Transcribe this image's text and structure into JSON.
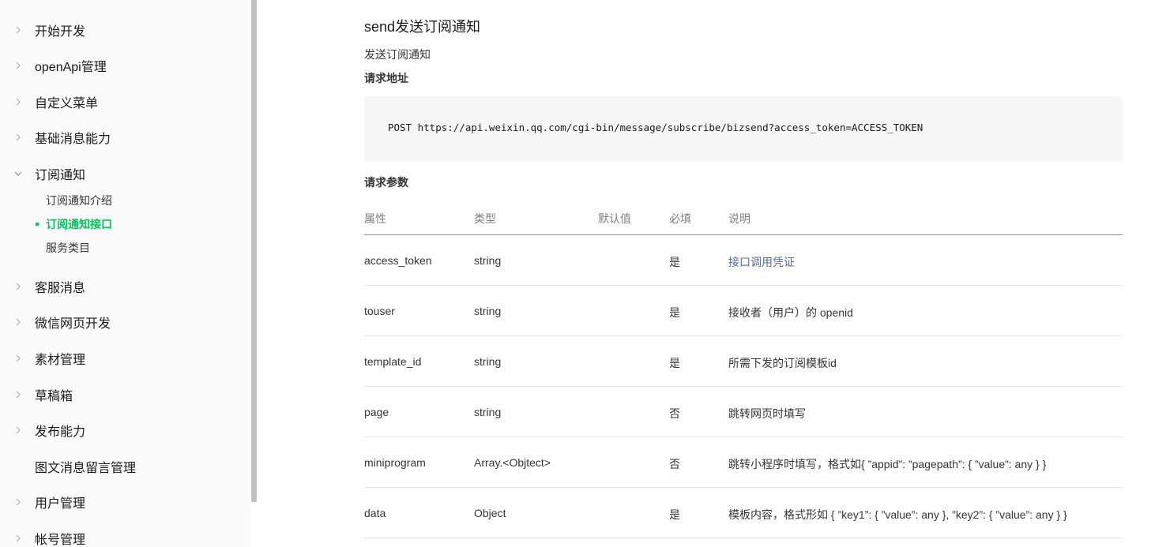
{
  "sidebar": {
    "items": [
      {
        "label": "开始开发"
      },
      {
        "label": "openApi管理"
      },
      {
        "label": "自定义菜单"
      },
      {
        "label": "基础消息能力"
      },
      {
        "label": "订阅通知",
        "expanded": true,
        "children": [
          {
            "label": "订阅通知介绍"
          },
          {
            "label": "订阅通知接口",
            "active": true
          },
          {
            "label": "服务类目"
          }
        ]
      },
      {
        "label": "客服消息"
      },
      {
        "label": "微信网页开发"
      },
      {
        "label": "素材管理"
      },
      {
        "label": "草稿箱"
      },
      {
        "label": "发布能力"
      },
      {
        "label": "图文消息留言管理"
      },
      {
        "label": "用户管理"
      },
      {
        "label": "帐号管理"
      }
    ]
  },
  "main": {
    "title": "send发送订阅通知",
    "description": "发送订阅通知",
    "request_url_heading": "请求地址",
    "request_url": "POST https://api.weixin.qq.com/cgi-bin/message/subscribe/bizsend?access_token=ACCESS_TOKEN",
    "params_heading": "请求参数",
    "table": {
      "headers": [
        "属性",
        "类型",
        "默认值",
        "必填",
        "说明"
      ],
      "rows": [
        {
          "name": "access_token",
          "type": "string",
          "default": "",
          "required": "是",
          "desc": "接口调用凭证"
        },
        {
          "name": "touser",
          "type": "string",
          "default": "",
          "required": "是",
          "desc": "接收者（用户）的 openid"
        },
        {
          "name": "template_id",
          "type": "string",
          "default": "",
          "required": "是",
          "desc": "所需下发的订阅模板id"
        },
        {
          "name": "page",
          "type": "string",
          "default": "",
          "required": "否",
          "desc": "跳转网页时填写"
        },
        {
          "name": "miniprogram",
          "type": "Array.<Objtect>",
          "default": "",
          "required": "否",
          "desc": "跳转小程序时填写，格式如{ ”appid”: ”pagepath”: { ”value”: any } }"
        },
        {
          "name": "data",
          "type": "Object",
          "default": "",
          "required": "是",
          "desc": "模板内容，格式形如 { ”key1”: { ”value”: any }, ”key2”: { ”value”: any } }"
        }
      ]
    }
  },
  "colors": {
    "accent_green": "#07c160",
    "link_blue": "#576b95"
  }
}
